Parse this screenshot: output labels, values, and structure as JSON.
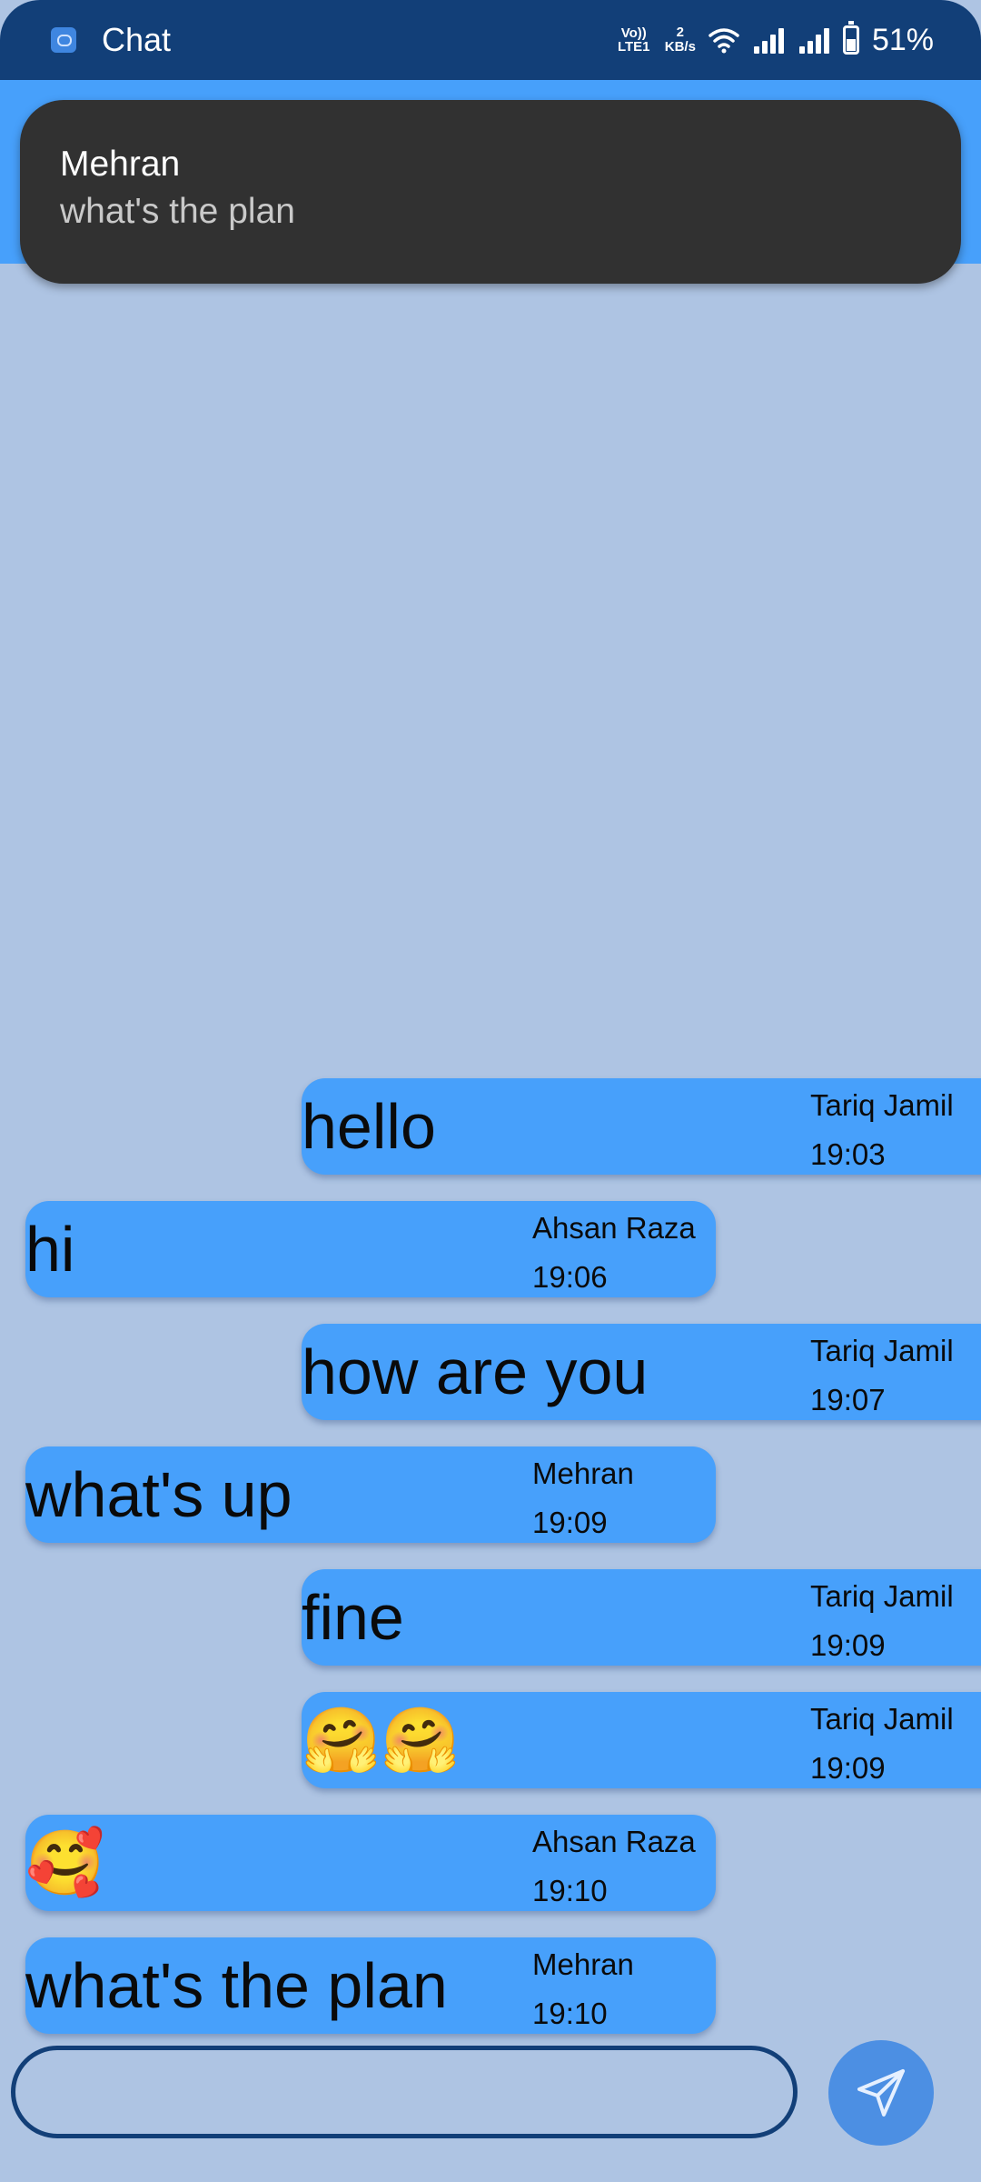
{
  "status_bar": {
    "app_name": "Chat",
    "volte": "Vo)) LTE1",
    "net_speed_value": "2",
    "net_speed_unit": "KB/s",
    "battery": "51%",
    "battery_level": 0.51,
    "icons": [
      "chat-app-icon",
      "volte-icon",
      "wifi-icon",
      "signal-icon",
      "signal-icon",
      "battery-icon"
    ]
  },
  "notification": {
    "sender": "Mehran",
    "text": "what's the plan"
  },
  "messages": [
    {
      "side": "right",
      "text": "hello",
      "sender": "Tariq Jamil",
      "time": "19:03"
    },
    {
      "side": "left",
      "text": "hi",
      "sender": "Ahsan Raza",
      "time": "19:06"
    },
    {
      "side": "right",
      "text": "how are you",
      "sender": "Tariq Jamil",
      "time": "19:07"
    },
    {
      "side": "left",
      "text": "what's up",
      "sender": "Mehran",
      "time": "19:09"
    },
    {
      "side": "right",
      "text": "fine",
      "sender": "Tariq Jamil",
      "time": "19:09"
    },
    {
      "side": "right",
      "text": "🤗🤗",
      "sender": "Tariq Jamil",
      "time": "19:09"
    },
    {
      "side": "left",
      "text": "🥰",
      "sender": "Ahsan Raza",
      "time": "19:10"
    },
    {
      "side": "left",
      "text": "what's the plan",
      "sender": "Mehran",
      "time": "19:10"
    }
  ],
  "composer": {
    "value": "",
    "placeholder": "",
    "send_icon": "send-icon"
  },
  "colors": {
    "background": "#aec4e3",
    "status_bar": "#123f78",
    "bubble": "#47a0fb",
    "notification": "#313131",
    "send_button": "#4c8fe3"
  }
}
